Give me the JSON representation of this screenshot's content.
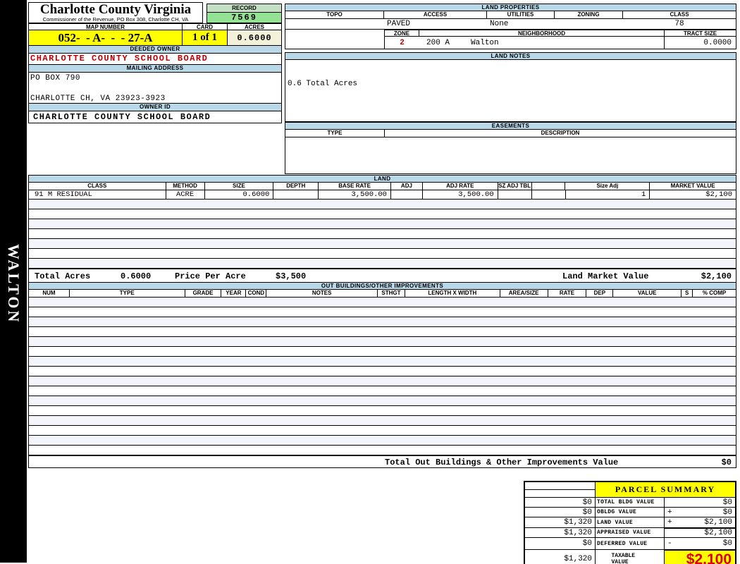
{
  "header": {
    "county_title": "Charlotte County Virginia",
    "county_subtitle": "Commissioner of the Revenue, PO Box 308, Charlotte CH, VA",
    "record_label": "RECORD",
    "record_value": "7569",
    "map_number_label": "MAP NUMBER",
    "map_number_value": "052-  - A-  -  - 27-A",
    "card_label": "CARD",
    "card_value": "1 of 1",
    "acres_label": "ACRES",
    "acres_value": "0.6000"
  },
  "owner": {
    "deeded_owner_label": "DEEDED OWNER",
    "deeded_owner": "CHARLOTTE COUNTY SCHOOL BOARD",
    "mailing_address_label": "MAILING ADDRESS",
    "address_line1": "PO BOX 790",
    "address_line2": "CHARLOTTE CH, VA 23923-3923",
    "owner_id_label": "OWNER ID",
    "owner_id": "CHARLOTTE COUNTY SCHOOL BOARD"
  },
  "sidebar": {
    "vertical_label": "WALTON"
  },
  "land_properties": {
    "section_label": "LAND PROPERTIES",
    "topo_label": "TOPO",
    "access_label": "ACCESS",
    "utilities_label": "UTILITIES",
    "zoning_label": "ZONING",
    "class_label": "CLASS",
    "access": "PAVED",
    "utilities": "None",
    "class": "78",
    "zone_label": "ZONE",
    "neighborhood_label": "NEIGHBORHOOD",
    "tract_size_label": "TRACT SIZE",
    "zone": "2",
    "neighborhood_code": "200 A",
    "neighborhood_name": "Walton",
    "tract_size": "0.0000"
  },
  "land_notes": {
    "section_label": "LAND NOTES",
    "note": "0.6 Total Acres"
  },
  "easements": {
    "section_label": "EASEMENTS",
    "type_label": "TYPE",
    "description_label": "DESCRIPTION"
  },
  "land": {
    "section_label": "LAND",
    "columns": [
      "CLASS",
      "METHOD",
      "SIZE",
      "DEPTH",
      "BASE RATE",
      "ADJ",
      "ADJ RATE",
      "SZ ADJ TBL",
      "",
      "Size Adj",
      "MARKET VALUE"
    ],
    "rows": [
      {
        "class": "91 M RESIDUAL",
        "method": "ACRE",
        "size": "0.6000",
        "depth": "",
        "base_rate": "3,500.00",
        "adj": "",
        "adj_rate": "3,500.00",
        "sz_adj_tbl": "",
        "size_adj": "1",
        "market_value": "$2,100"
      }
    ],
    "total_acres_label": "Total Acres",
    "total_acres": "0.6000",
    "price_per_acre_label": "Price Per Acre",
    "price_per_acre": "$3,500",
    "land_market_value_label": "Land Market Value",
    "land_market_value": "$2,100"
  },
  "out_buildings": {
    "section_label": "OUT BUILDINGS/OTHER IMPROVEMENTS",
    "columns": [
      "NUM",
      "TYPE",
      "GRADE",
      "YEAR",
      "COND",
      "NOTES",
      "STHGT",
      "LENGTH X WIDTH",
      "AREA/SIZE",
      "RATE",
      "DEP",
      "VALUE",
      "S",
      "% COMP"
    ],
    "total_label": "Total Out Buildings & Other Improvements Value",
    "total_value": "$0"
  },
  "parcel_summary": {
    "title": "PARCEL SUMMARY",
    "rows": [
      {
        "prior": "$0",
        "label": "TOTAL BLDG VALUE",
        "op": "",
        "value": "$0"
      },
      {
        "prior": "$0",
        "label": "OBLDG VALUE",
        "op": "+",
        "value": "$0"
      },
      {
        "prior": "$1,320",
        "label": "LAND VALUE",
        "op": "+",
        "value": "$2,100"
      },
      {
        "prior": "$1,320",
        "label": "APPRAISED VALUE",
        "op": "",
        "value": "$2,100"
      },
      {
        "prior": "$0",
        "label": "DEFERRED VALUE",
        "op": "-",
        "value": "$0"
      }
    ],
    "taxable": {
      "prior": "$1,320",
      "label": "TAXABLE VALUE",
      "value": "$2,100"
    }
  },
  "colors": {
    "section_header_blue": "#b9d8e8",
    "highlight_yellow": "#ffff00",
    "record_header_green": "#c4e0c4",
    "record_value_green": "#94e294",
    "acres_cream": "#f3f1da",
    "stripe_lavender": "#f4f4fb",
    "alert_red": "#c00000",
    "taxable_red": "#dd0000",
    "sidebar_black": "#000000"
  }
}
